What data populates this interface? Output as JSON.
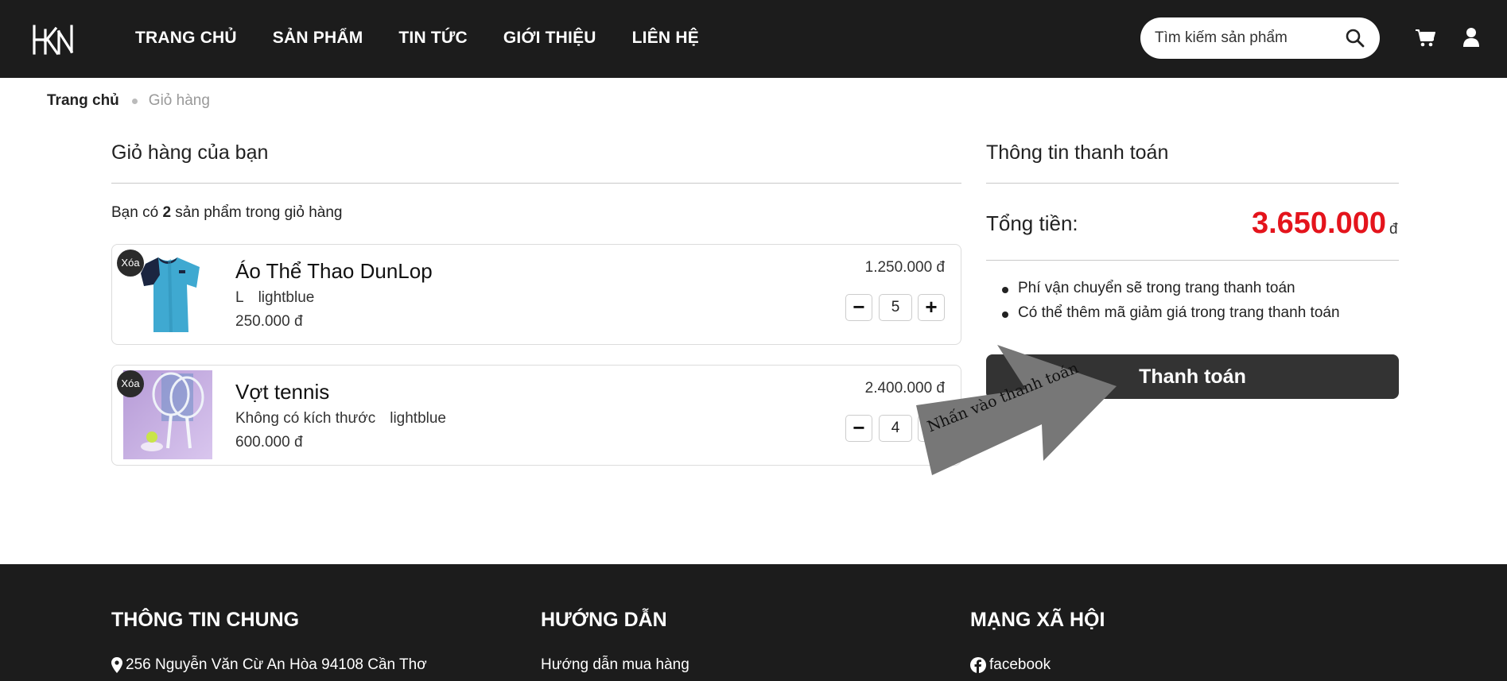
{
  "header": {
    "logo_text": "HKN",
    "nav": [
      "TRANG CHỦ",
      "SẢN PHẨM",
      "TIN TỨC",
      "GIỚI THIỆU",
      "LIÊN HỆ"
    ],
    "search_placeholder": "Tìm kiếm sản phẩm"
  },
  "breadcrumb": {
    "home": "Trang chủ",
    "current": "Giỏ hàng"
  },
  "cart": {
    "title": "Giỏ hàng của bạn",
    "count_prefix": "Bạn có",
    "count": "2",
    "count_suffix": "sản phẩm trong giỏ hàng",
    "remove_label": "Xóa",
    "items": [
      {
        "name": "Áo Thể Thao DunLop",
        "size": "L",
        "color": "lightblue",
        "price": "250.000 đ",
        "quantity": "5",
        "line_total": "1.250.000 đ",
        "image": "blue-sport-shirt"
      },
      {
        "name": "Vợt tennis",
        "size": "Không có kích thước",
        "color": "lightblue",
        "price": "600.000 đ",
        "quantity": "4",
        "line_total": "2.400.000 đ",
        "image": "tennis-racket"
      }
    ]
  },
  "payment": {
    "title": "Thông tin thanh toán",
    "total_label": "Tổng tiền:",
    "total_value": "3.650.000",
    "total_unit": "đ",
    "notes": [
      "Phí vận chuyển sẽ trong trang thanh toán",
      "Có thể thêm mã giảm giá trong trang thanh toán"
    ],
    "checkout_label": "Thanh toán",
    "total_color": "#e4141c"
  },
  "annotation": {
    "text": "Nhấn vào thanh toán"
  },
  "footer": {
    "col1_title": "THÔNG TIN CHUNG",
    "address": "256 Nguyễn Văn Cừ An Hòa 94108 Cần Thơ",
    "col2_title": "HƯỚNG DẪN",
    "guide_link": "Hướng dẫn mua hàng",
    "col3_title": "MẠNG XÃ HỘI",
    "social_link": "facebook"
  }
}
